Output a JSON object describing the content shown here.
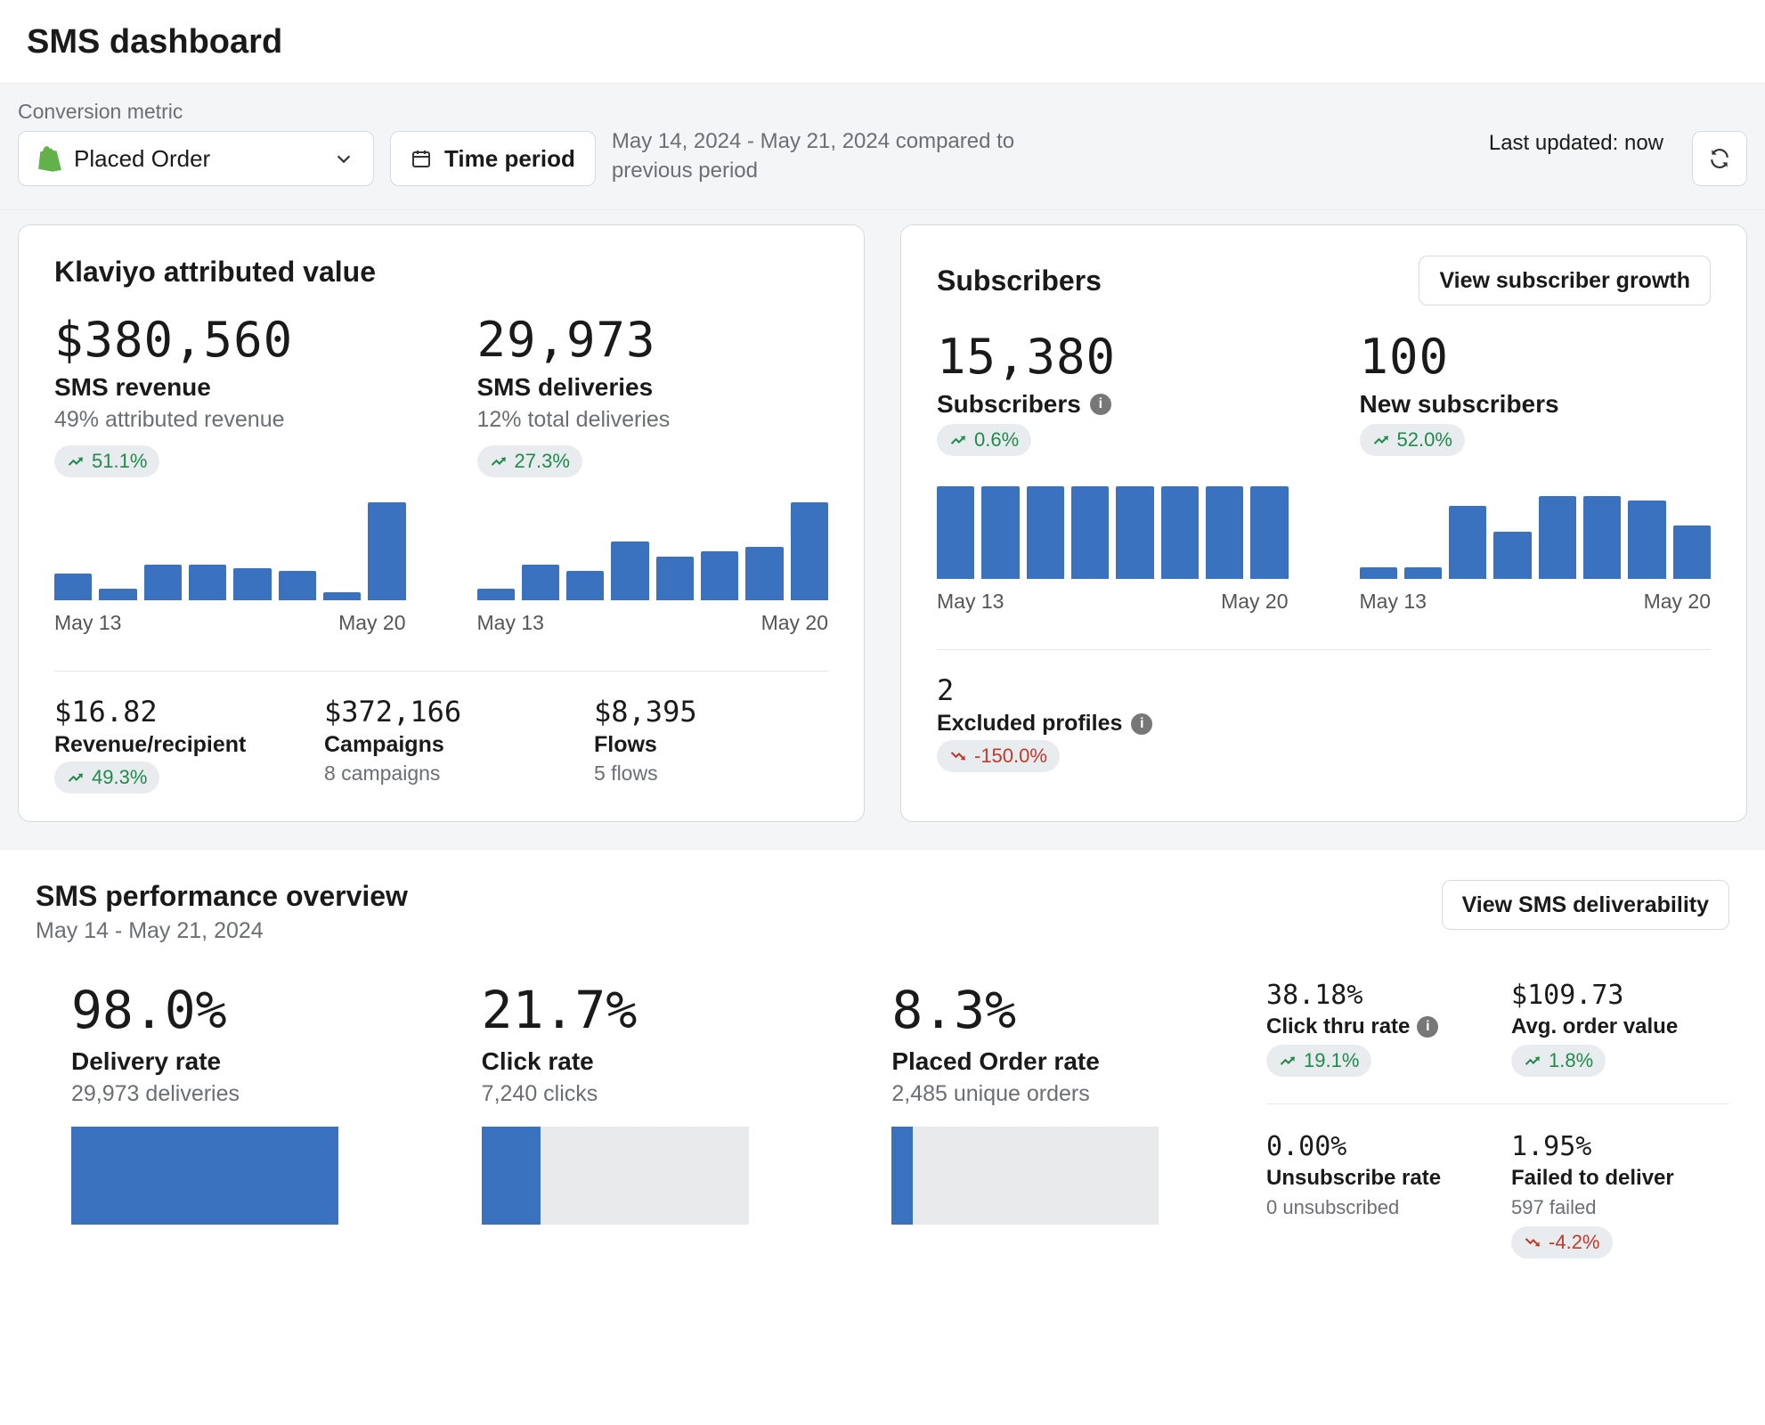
{
  "page": {
    "title": "SMS dashboard"
  },
  "controls": {
    "metric_label": "Conversion metric",
    "metric_value": "Placed Order",
    "time_button": "Time period",
    "date_note": "May 14, 2024 - May 21, 2024 compared to previous period",
    "last_updated": "Last updated: now"
  },
  "attributed": {
    "title": "Klaviyo attributed value",
    "revenue": {
      "value": "$380,560",
      "label": "SMS revenue",
      "sub": "49% attributed revenue",
      "delta": "51.1%",
      "delta_dir": "up"
    },
    "deliveries": {
      "value": "29,973",
      "label": "SMS deliveries",
      "sub": "12% total deliveries",
      "delta": "27.3%",
      "delta_dir": "up"
    },
    "axis_start": "May 13",
    "axis_end": "May 20",
    "sub": {
      "rpp": {
        "value": "$16.82",
        "label": "Revenue/recipient",
        "delta": "49.3%",
        "delta_dir": "up"
      },
      "camp": {
        "value": "$372,166",
        "label": "Campaigns",
        "note": "8 campaigns"
      },
      "flows": {
        "value": "$8,395",
        "label": "Flows",
        "note": "5 flows"
      }
    }
  },
  "subscribers": {
    "title": "Subscribers",
    "button": "View subscriber growth",
    "subs": {
      "value": "15,380",
      "label": "Subscribers",
      "delta": "0.6%",
      "delta_dir": "up"
    },
    "new": {
      "value": "100",
      "label": "New subscribers",
      "delta": "52.0%",
      "delta_dir": "up"
    },
    "axis_start": "May 13",
    "axis_end": "May 20",
    "excluded": {
      "value": "2",
      "label": "Excluded profiles",
      "delta": "-150.0%",
      "delta_dir": "down"
    }
  },
  "perf": {
    "title": "SMS performance overview",
    "range": "May 14 - May 21, 2024",
    "button": "View SMS deliverability",
    "delivery": {
      "value": "98.0%",
      "label": "Delivery rate",
      "note": "29,973 deliveries"
    },
    "click": {
      "value": "21.7%",
      "label": "Click rate",
      "note": "7,240 clicks"
    },
    "placed": {
      "value": "8.3%",
      "label": "Placed Order rate",
      "note": "2,485 unique orders"
    },
    "side": {
      "ctr": {
        "value": "38.18%",
        "label": "Click thru rate",
        "delta": "19.1%",
        "delta_dir": "up"
      },
      "aov": {
        "value": "$109.73",
        "label": "Avg. order value",
        "delta": "1.8%",
        "delta_dir": "up"
      },
      "unsub": {
        "value": "0.00%",
        "label": "Unsubscribe rate",
        "note": "0 unsubscribed"
      },
      "fail": {
        "value": "1.95%",
        "label": "Failed to deliver",
        "note": "597 failed",
        "delta": "-4.2%",
        "delta_dir": "down"
      }
    }
  },
  "chart_data": [
    {
      "type": "bar",
      "title": "SMS revenue",
      "categories": [
        "May 13",
        "May 14",
        "May 15",
        "May 16",
        "May 17",
        "May 18",
        "May 19",
        "May 20"
      ],
      "values": [
        27,
        12,
        36,
        36,
        33,
        30,
        8,
        100
      ],
      "xlabel": "",
      "ylabel": "",
      "ylim": [
        0,
        100
      ]
    },
    {
      "type": "bar",
      "title": "SMS deliveries",
      "categories": [
        "May 13",
        "May 14",
        "May 15",
        "May 16",
        "May 17",
        "May 18",
        "May 19",
        "May 20"
      ],
      "values": [
        12,
        36,
        30,
        60,
        45,
        50,
        55,
        100
      ],
      "xlabel": "",
      "ylabel": "",
      "ylim": [
        0,
        100
      ]
    },
    {
      "type": "bar",
      "title": "Subscribers",
      "categories": [
        "May 13",
        "May 14",
        "May 15",
        "May 16",
        "May 17",
        "May 18",
        "May 19",
        "May 20"
      ],
      "values": [
        95,
        95,
        95,
        95,
        95,
        95,
        95,
        95
      ],
      "xlabel": "",
      "ylabel": "",
      "ylim": [
        0,
        100
      ]
    },
    {
      "type": "bar",
      "title": "New subscribers",
      "categories": [
        "May 13",
        "May 14",
        "May 15",
        "May 16",
        "May 17",
        "May 18",
        "May 19",
        "May 20"
      ],
      "values": [
        12,
        12,
        75,
        48,
        85,
        85,
        80,
        55
      ],
      "xlabel": "",
      "ylabel": "",
      "ylim": [
        0,
        100
      ]
    }
  ]
}
